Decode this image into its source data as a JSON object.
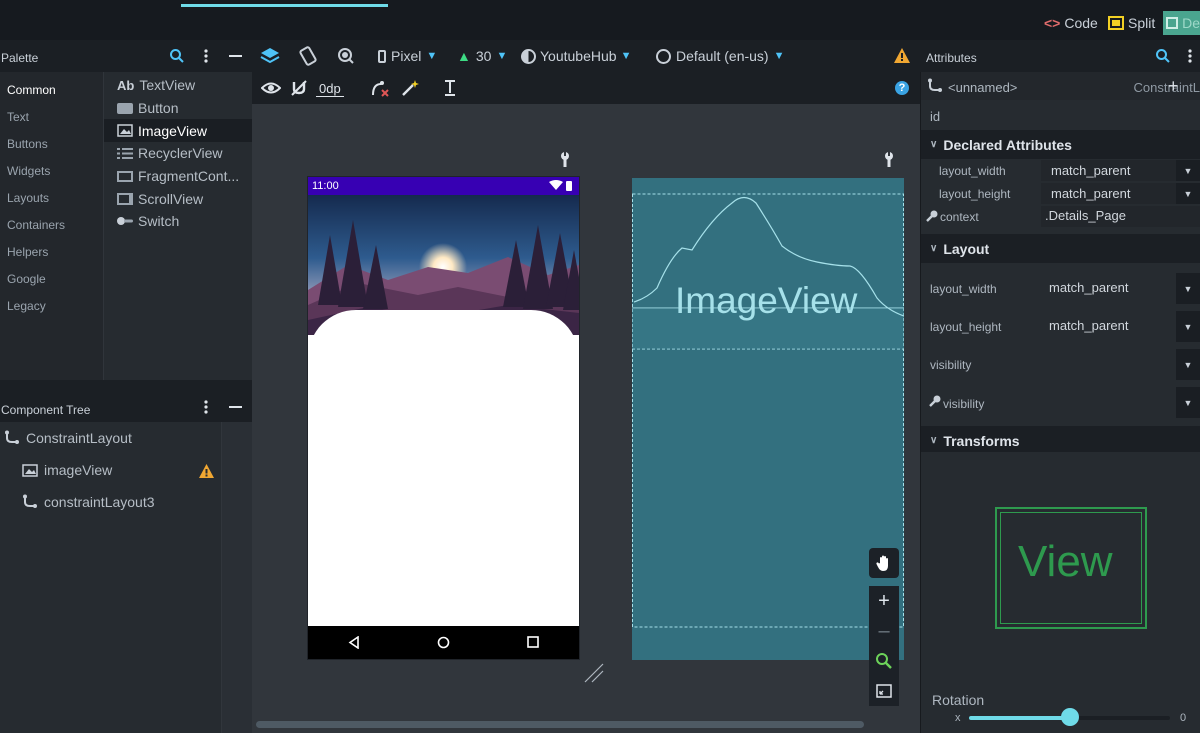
{
  "topbar": {
    "modes": {
      "code": "Code",
      "split": "Split",
      "design": "De"
    }
  },
  "palette": {
    "title": "Palette",
    "categories": [
      "Common",
      "Text",
      "Buttons",
      "Widgets",
      "Layouts",
      "Containers",
      "Helpers",
      "Google",
      "Legacy"
    ],
    "items": [
      "TextView",
      "Button",
      "ImageView",
      "RecyclerView",
      "FragmentCont...",
      "ScrollView",
      "Switch"
    ],
    "textview_glyph": "Ab"
  },
  "toolbar": {
    "device": "Pixel",
    "api": "30",
    "theme": "YoutubeHub",
    "locale": "Default (en-us)",
    "margin": "0dp"
  },
  "component_tree": {
    "title": "Component Tree",
    "nodes": [
      "ConstraintLayout",
      "imageView",
      "constraintLayout3"
    ]
  },
  "phone": {
    "time": "11:00"
  },
  "blueprint": {
    "label": "ImageView"
  },
  "attributes": {
    "title": "Attributes",
    "component": "<unnamed>",
    "component_type": "ConstraintL",
    "id_label": "id",
    "declared": {
      "title": "Declared Attributes",
      "rows": [
        {
          "name": "layout_width",
          "value": "match_parent"
        },
        {
          "name": "layout_height",
          "value": "match_parent"
        },
        {
          "name": "context",
          "value": ".Details_Page"
        }
      ]
    },
    "layout": {
      "title": "Layout",
      "rows": [
        {
          "name": "layout_width",
          "value": "match_parent"
        },
        {
          "name": "layout_height",
          "value": "match_parent"
        },
        {
          "name": "visibility",
          "value": ""
        },
        {
          "name": "visibility",
          "value": ""
        }
      ]
    },
    "transforms": {
      "title": "Transforms",
      "preview": "View",
      "rotation_label": "Rotation",
      "axis": "x",
      "rotation_value": "0",
      "slider_fraction": 0.5
    }
  },
  "colors": {
    "accent": "#6fdbe8",
    "warning": "#f0a732",
    "status_bar": "#3700b3",
    "blueprint": "#33707f",
    "view_preview": "#2e9a4e"
  }
}
